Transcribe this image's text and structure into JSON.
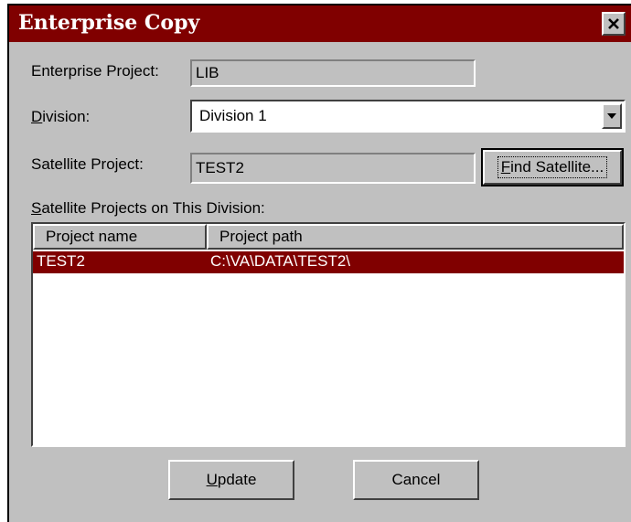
{
  "window": {
    "title": "Enterprise Copy"
  },
  "fields": {
    "enterprise_project": {
      "label": "Enterprise Project:",
      "value": "LIB"
    },
    "division": {
      "label_prefix": "D",
      "label_rest": "ivision:",
      "value": "Division 1"
    },
    "satellite_project": {
      "label": "Satellite Project:",
      "value": "TEST2"
    }
  },
  "buttons": {
    "find_satellite": {
      "mnemonic": "F",
      "rest": "ind Satellite..."
    },
    "update": {
      "mnemonic": "U",
      "rest": "pdate"
    },
    "cancel": {
      "label": "Cancel"
    }
  },
  "list": {
    "label_prefix": "S",
    "label_rest": "atellite Projects on This Division:",
    "columns": [
      "Project name",
      "Project path"
    ],
    "rows": [
      {
        "name": "TEST2",
        "path": "C:\\VA\\DATA\\TEST2\\",
        "selected": true
      }
    ]
  },
  "colors": {
    "title_bar": "#800000",
    "selection": "#800000",
    "dialog_face": "#c0c0c0"
  },
  "icons": {
    "close": "close-icon",
    "dropdown": "chevron-down-icon"
  }
}
